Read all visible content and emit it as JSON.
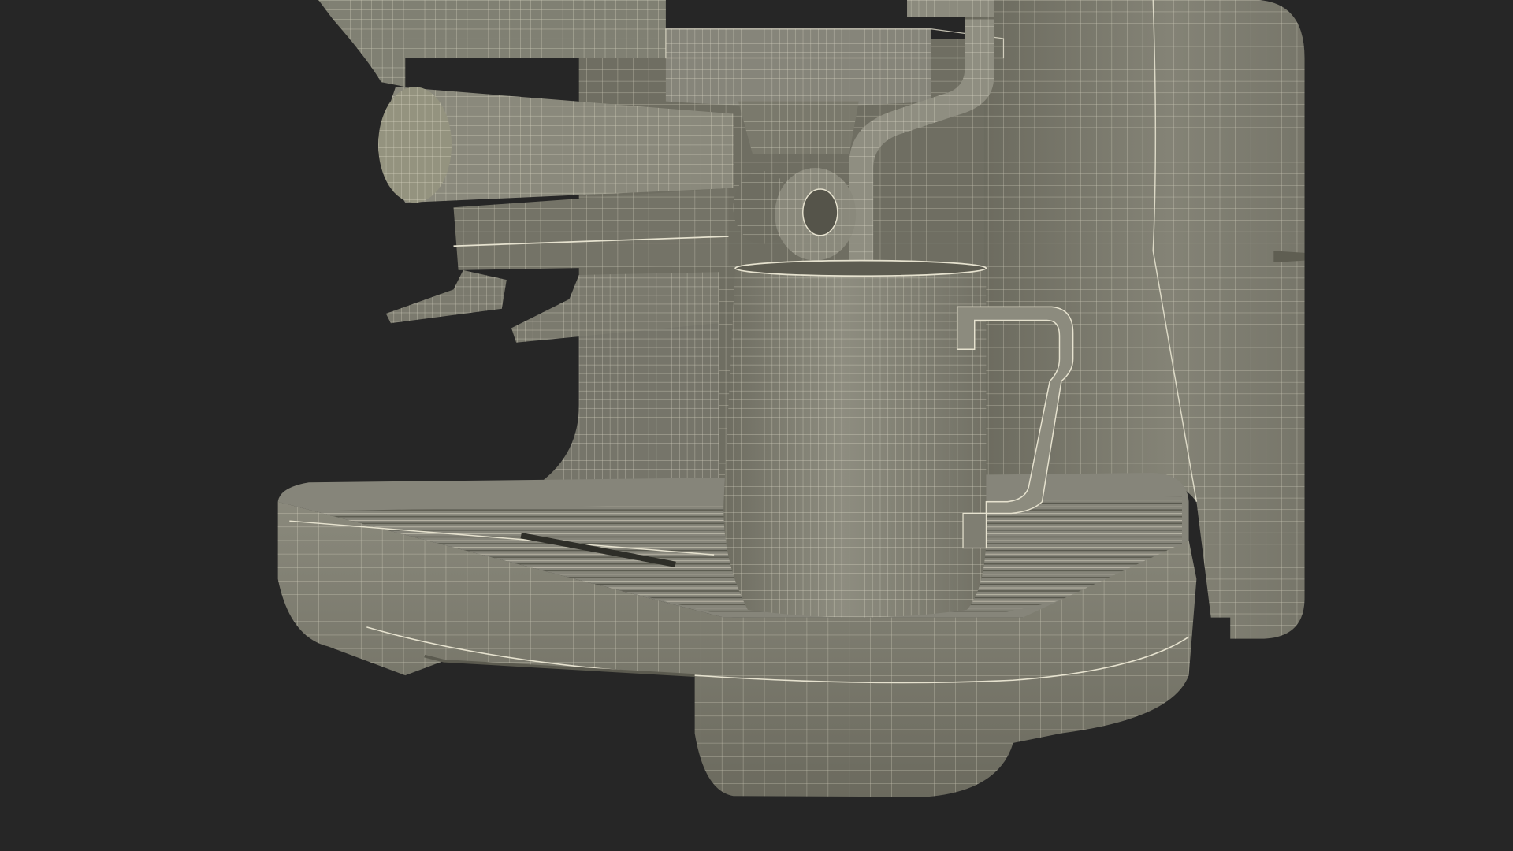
{
  "scene": {
    "subject": "espresso-machine-wireframe",
    "parts": [
      "machine-body",
      "group-head",
      "portafilter",
      "steam-wand",
      "steam-knob",
      "drip-tray",
      "drip-grate",
      "milk-pitcher",
      "pitcher-handle"
    ]
  },
  "colors": {
    "background": "#262626",
    "surface": "#7d7c6e",
    "surface_light": "#8f8e80",
    "surface_shade": "#5f5e52",
    "wire": "#e6e2cf"
  }
}
